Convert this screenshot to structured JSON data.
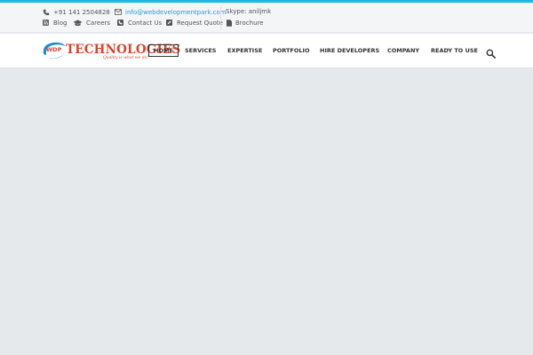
{
  "topbar": {
    "phone": "+91 141 2504828",
    "email": "info@webdevelopmentpark.com",
    "skype": "Skype: aniljmk",
    "links": {
      "blog": "Blog",
      "careers": "Careers",
      "contact": "Contact Us",
      "quote": "Request Quote",
      "brochure": "Brochure"
    }
  },
  "logo": {
    "badge": "WDP",
    "name": "TECHNOLOGIES",
    "tagline": "Quality is what we do!"
  },
  "nav": {
    "home": "HOME",
    "services": "SERVICES",
    "expertise": "EXPERTISE",
    "portfolio": "PORTFOLIO",
    "hire": "HIRE DEVELOPERS",
    "company": "COMPANY",
    "ready": "READY TO USE"
  },
  "colors": {
    "accent": "#1fb5e6",
    "brand_red": "#d8452f",
    "brand_blue": "#1a8fd6",
    "page_bg": "#e6e9ec"
  }
}
